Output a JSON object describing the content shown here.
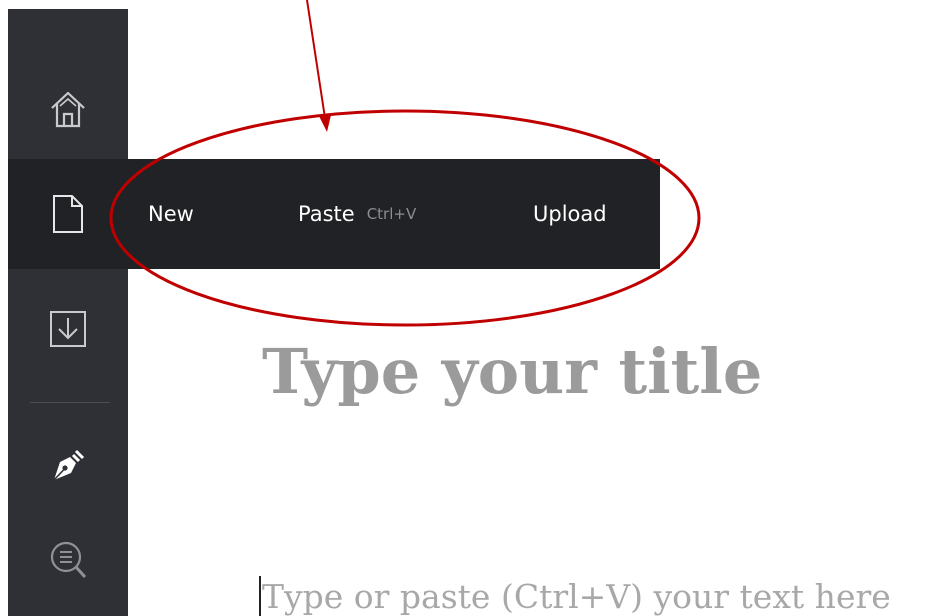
{
  "sidebar": {
    "items": [
      {
        "icon": "home-icon"
      },
      {
        "icon": "document-icon",
        "active": true
      },
      {
        "icon": "download-icon"
      },
      {
        "icon": "pen-icon"
      },
      {
        "icon": "search-document-icon"
      }
    ]
  },
  "flyout_menu": {
    "items": [
      {
        "label": "New"
      },
      {
        "label": "Paste",
        "shortcut": "Ctrl+V"
      },
      {
        "label": "Upload"
      }
    ]
  },
  "editor": {
    "title_placeholder": "Type your title",
    "body_placeholder": "Type or paste (Ctrl+V) your text here"
  },
  "annotation": {
    "color": "#c00000",
    "shapes": [
      "arrow",
      "ellipse"
    ]
  },
  "colors": {
    "sidebar_bg": "#2e3035",
    "active_bg": "#212225",
    "menu_text": "#ffffff",
    "placeholder_text": "#9b9b9b"
  }
}
